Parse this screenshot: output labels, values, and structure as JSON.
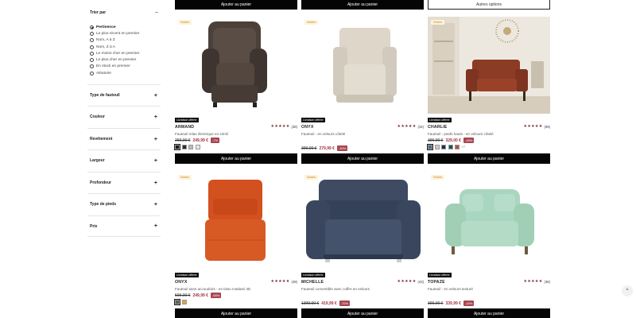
{
  "sidebar": {
    "sort_title": "Trier par",
    "sort_options": [
      "Pertinence",
      "Le plus récent en premier",
      "Nom, A à Z",
      "Nom, Z à A",
      "Le moins cher en premier",
      "Le plus cher en premier",
      "En stock en premier",
      "Aléatoire"
    ],
    "selected_sort": "Pertinence",
    "filters": [
      "Type de fauteuil",
      "Couleur",
      "Revêtement",
      "Largeur",
      "Profondeur",
      "Type de pieds",
      "Prix"
    ]
  },
  "top_buttons": [
    "Ajouter au panier",
    "Ajouter au panier",
    "Autres options"
  ],
  "products": [
    {
      "badge": "Soldes",
      "delivery": "Livraison offerte",
      "name": "ARMAND",
      "stars": "★★★★★",
      "review_count": "(38)",
      "desc": "Fauteuil relax électrique en simili",
      "old_price": "269,00 €",
      "new_price": "249,99 €",
      "discount": "-7%",
      "swatches": [
        "#1a1a1a",
        "#3a2a22",
        "#b9b9b9",
        "#ece7df"
      ],
      "more": "",
      "button": "Ajouter au panier"
    },
    {
      "badge": "Soldes",
      "delivery": "Livraison offerte",
      "name": "ONYX",
      "stars": "★★★★★",
      "review_count": "(34)",
      "desc": "Fauteuil - en velours côtelé",
      "old_price": "399,00 €",
      "new_price": "279,99 €",
      "discount": "-30%",
      "swatches": [],
      "more": "",
      "button": "Ajouter au panier"
    },
    {
      "badge": "Soldes",
      "delivery": "Livraison offerte",
      "name": "CHARLIE",
      "stars": "★★★★★",
      "review_count": "(69)",
      "desc": "Fauteuil - pieds hauts - en velours côtelé",
      "old_price": "399,00 €",
      "new_price": "329,00 €",
      "discount": "-18%",
      "swatches": [
        "#4a6e8a",
        "#cfcac2",
        "#1b2f4a",
        "#0f5a56",
        "#b2543a"
      ],
      "more": "+7",
      "button": "Ajouter au panier"
    },
    {
      "badge": "Soldes",
      "delivery": "Livraison offerte",
      "name": "ONYX",
      "stars": "★★★★★",
      "review_count": "(49)",
      "desc": "Fauteuil sans accoudoirs - en tissu matlasé 3D",
      "old_price": "599,00 €",
      "new_price": "249,99 €",
      "discount": "-58%",
      "swatches": [
        "#5f604a",
        "#d8a846"
      ],
      "more": "",
      "button": "Ajouter au panier"
    },
    {
      "badge": "Soldes",
      "delivery": "Livraison offerte",
      "name": "MICHELLE",
      "stars": "★★★★★",
      "review_count": "(43)",
      "desc": "Fauteuil convertible avec coffre en velours",
      "old_price": "1399,00 €",
      "new_price": "419,99 €",
      "discount": "-70%",
      "swatches": [],
      "more": "",
      "button": "Ajouter au panier"
    },
    {
      "badge": "Soldes",
      "delivery": "Livraison offerte",
      "name": "TOPAZE",
      "stars": "★★★★★",
      "review_count": "(38)",
      "desc": "Fauteuil - en velours texturé",
      "old_price": "399,00 €",
      "new_price": "339,99 €",
      "discount": "-15%",
      "swatches": [],
      "more": "",
      "button": "Ajouter au panier"
    }
  ],
  "icons": {
    "minus": "−",
    "plus": "+",
    "scroll_top": "^"
  }
}
